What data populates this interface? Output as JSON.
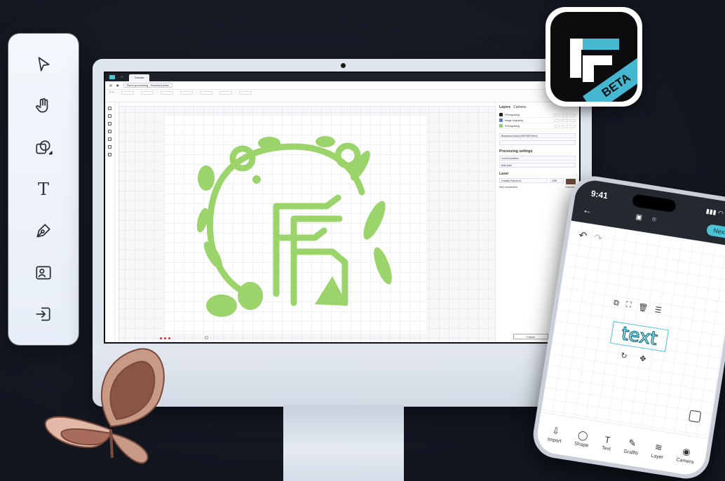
{
  "side_toolbar": {
    "tools": [
      {
        "name": "select",
        "icon": "cursor-arrow-icon"
      },
      {
        "name": "pan",
        "icon": "hand-icon"
      },
      {
        "name": "shape",
        "icon": "shapes-icon"
      },
      {
        "name": "text",
        "icon": "text-icon",
        "glyph": "T"
      },
      {
        "name": "pen",
        "icon": "pen-icon"
      },
      {
        "name": "image",
        "icon": "image-icon"
      },
      {
        "name": "import",
        "icon": "import-icon"
      }
    ]
  },
  "desktop_app": {
    "tab_label": "Canvas",
    "file_label": "Plane processing - Standard plate",
    "right_panel": {
      "tabs": [
        "Layers",
        "Camera"
      ],
      "layers": [
        {
          "name": "Fill engraving",
          "color": "#222222"
        },
        {
          "name": "Image engraving",
          "color": "#5a7fc0"
        },
        {
          "name": "Fill engraving",
          "color": "#8ccf6a"
        }
      ],
      "material": "Basswood board (300*300*3mm)",
      "processing_title": "Processing settings",
      "start_position": "Current position",
      "processing_mode": "Auto plan",
      "laser_title": "Laser",
      "laser_device": "Creality Falcon A1",
      "laser_status": "Not connected",
      "laser_power": "10W",
      "connect_label": "Connect",
      "frame_label": "Frame",
      "start_label": "Start"
    }
  },
  "app_icon": {
    "beta_label": "BETA",
    "colors": {
      "accent": "#45b7d1",
      "background": "#0c0c0f"
    }
  },
  "phone": {
    "time": "9:41",
    "next_label": "Next",
    "canvas_text": "text",
    "bottom_nav": [
      {
        "label": "Import",
        "icon": "import-icon",
        "glyph": "⇩"
      },
      {
        "label": "Shape",
        "icon": "shape-icon",
        "glyph": "◯"
      },
      {
        "label": "Text",
        "icon": "text-icon",
        "glyph": "T"
      },
      {
        "label": "Graffiti",
        "icon": "brush-icon",
        "glyph": "✎"
      },
      {
        "label": "Layer",
        "icon": "layers-icon",
        "glyph": "≋"
      },
      {
        "label": "Camera",
        "icon": "camera-icon",
        "glyph": "◉"
      }
    ]
  },
  "colors": {
    "background": "#12161f",
    "artwork_green": "#9bd46a",
    "accent_cyan": "#4cc3d6"
  }
}
